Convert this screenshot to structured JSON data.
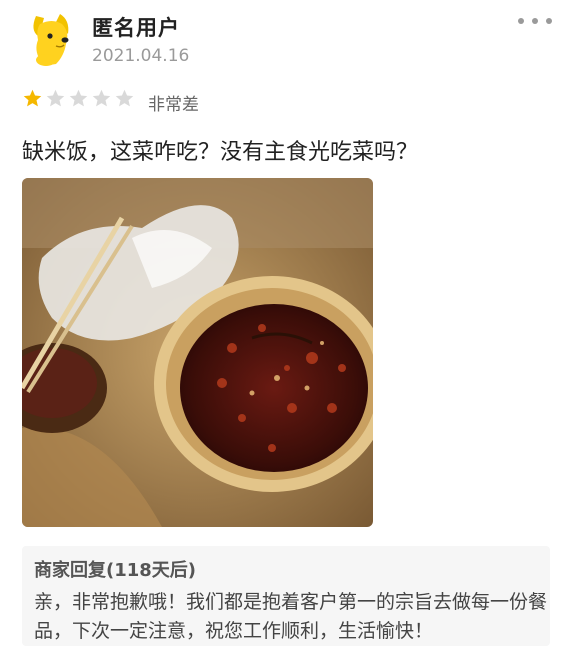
{
  "review": {
    "user": {
      "name": "匿名用户",
      "date": "2021.04.16",
      "avatar_icon": "yellow-dog-avatar-icon"
    },
    "rating": {
      "stars": 1,
      "max": 5,
      "label": "非常差",
      "active_color": "#f5b800",
      "inactive_color": "#d9d9d9"
    },
    "text": "缺米饭，这菜咋吃？没有主食光吃菜吗？",
    "more_icon": "more-dots-icon",
    "photo_icon": "food-photo-image"
  },
  "merchant_reply": {
    "title": "商家回复(118天后)",
    "text": "亲，非常抱歉哦！我们都是抱着客户第一的宗旨去做每一份餐品，下次一定注意，祝您工作顺利，生活愉快！"
  }
}
